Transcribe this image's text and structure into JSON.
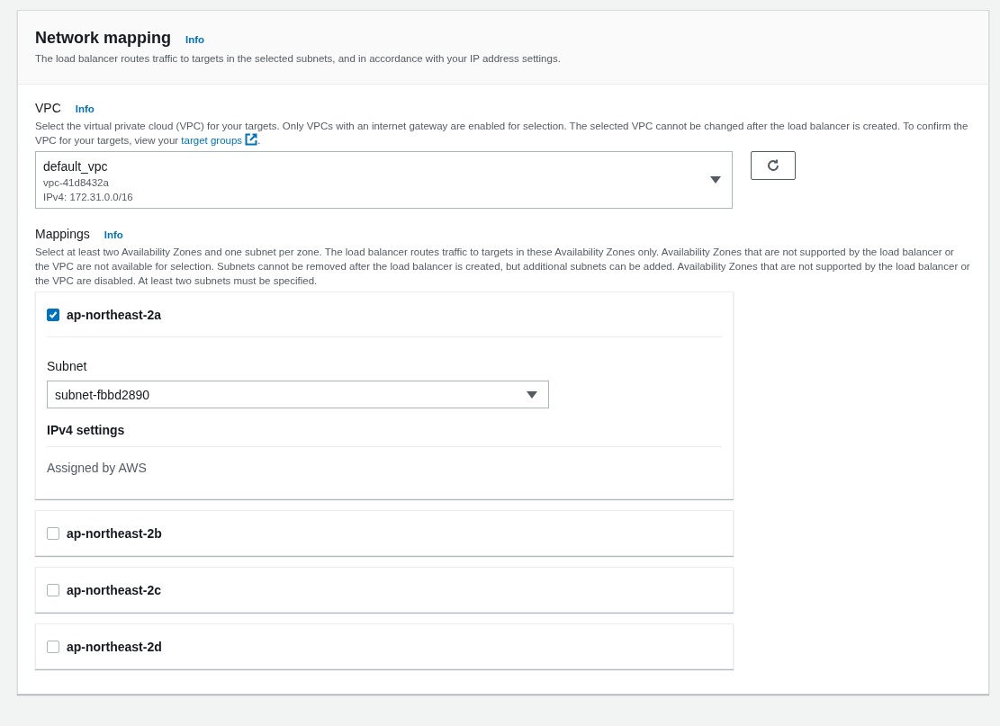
{
  "header": {
    "title": "Network mapping",
    "info": "Info",
    "description": "The load balancer routes traffic to targets in the selected subnets, and in accordance with your IP address settings."
  },
  "vpc": {
    "label": "VPC",
    "info": "Info",
    "description": "Select the virtual private cloud (VPC) for your targets. Only VPCs with an internet gateway are enabled for selection. The selected VPC cannot be changed after the load balancer is created. To confirm the VPC for your targets, view your",
    "link": "target groups",
    "after_link": ".",
    "select": {
      "name": "default_vpc",
      "id": "vpc-41d8432a",
      "cidr": "IPv4: 172.31.0.0/16"
    }
  },
  "mappings": {
    "label": "Mappings",
    "info": "Info",
    "description": "Select at least two Availability Zones and one subnet per zone. The load balancer routes traffic to targets in these Availability Zones only. Availability Zones that are not supported by the load balancer or the VPC are not available for selection. Subnets cannot be removed after the load balancer is created, but additional subnets can be added. Availability Zones that are not supported by the load balancer or the VPC are disabled. At least two subnets must be specified.",
    "zones": [
      {
        "name": "ap-northeast-2a",
        "checked": true,
        "subnet_label": "Subnet",
        "subnet": "subnet-fbbd2890",
        "ipv4_heading": "IPv4 settings",
        "ipv4": "Assigned by AWS"
      },
      {
        "name": "ap-northeast-2b",
        "checked": false
      },
      {
        "name": "ap-northeast-2c",
        "checked": false
      },
      {
        "name": "ap-northeast-2d",
        "checked": false
      }
    ]
  }
}
